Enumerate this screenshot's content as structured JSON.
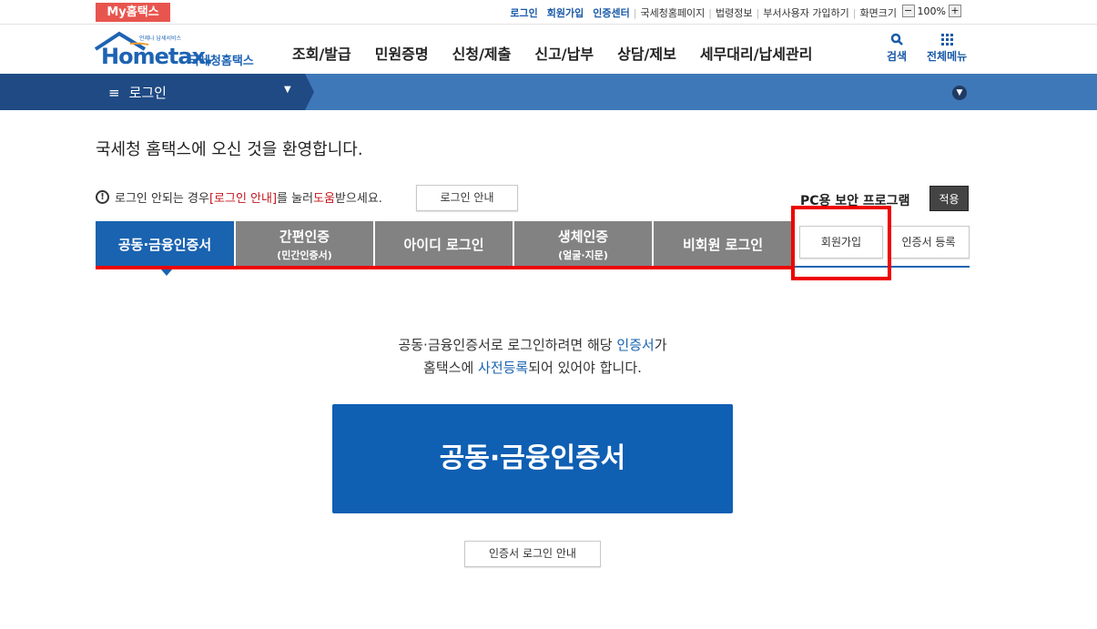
{
  "topbar": {
    "my_hometax": "My홈택스",
    "links": [
      "로그인",
      "회원가입",
      "인증센터"
    ],
    "plain_links": [
      "국세청홈페이지",
      "법령정보",
      "부서사용자 가입하기",
      "화면크기"
    ],
    "zoom_value": "100%",
    "zoom_minus": "−",
    "zoom_plus": "+"
  },
  "header": {
    "logo_text": "Hometax.",
    "logo_sub": "국세청홈택스",
    "logo_tag": "언제나 납세서비스",
    "menu": [
      "조회/발급",
      "민원증명",
      "신청/제출",
      "신고/납부",
      "상담/제보",
      "세무대리/납세관리"
    ],
    "search_label": "검색",
    "all_menu_label": "전체메뉴"
  },
  "location": {
    "label": "로그인",
    "menu_glyph": "≡"
  },
  "welcome": "국세청 홈택스에 오신 것을 환영합니다.",
  "notice": {
    "icon": "!",
    "part1": "로그인 안되는 경우 ",
    "part2": "[로그인 안내]",
    "part3": "를 눌러 ",
    "part4": "도움",
    "part5": "받으세요.",
    "button": "로그인 안내"
  },
  "pc_security": {
    "title": "PC용 보안 프로그램",
    "apply": "적용"
  },
  "tabs": [
    {
      "label": "공동·금융인증서",
      "sub": ""
    },
    {
      "label": "간편인증",
      "sub": "(민간인증서)"
    },
    {
      "label": "아이디 로그인",
      "sub": ""
    },
    {
      "label": "생체인증",
      "sub": "(얼굴·지문)"
    },
    {
      "label": "비회원 로그인",
      "sub": ""
    }
  ],
  "side_buttons": {
    "join": "회원가입",
    "cert_register": "인증서 등록"
  },
  "description": {
    "line1_a": "공동·금융인증서로 로그인하려면 해당 ",
    "line1_b": "인증서",
    "line1_c": "가",
    "line2_a": "홈택스에 ",
    "line2_b": "사전등록",
    "line2_c": "되어 있어야 합니다."
  },
  "cert_button": "공동·금융인증서",
  "cert_guide_button": "인증서 로그인 안내",
  "colors": {
    "brand_blue": "#1a63b0",
    "highlight_red": "#ee0000",
    "tab_gray": "#828282"
  }
}
